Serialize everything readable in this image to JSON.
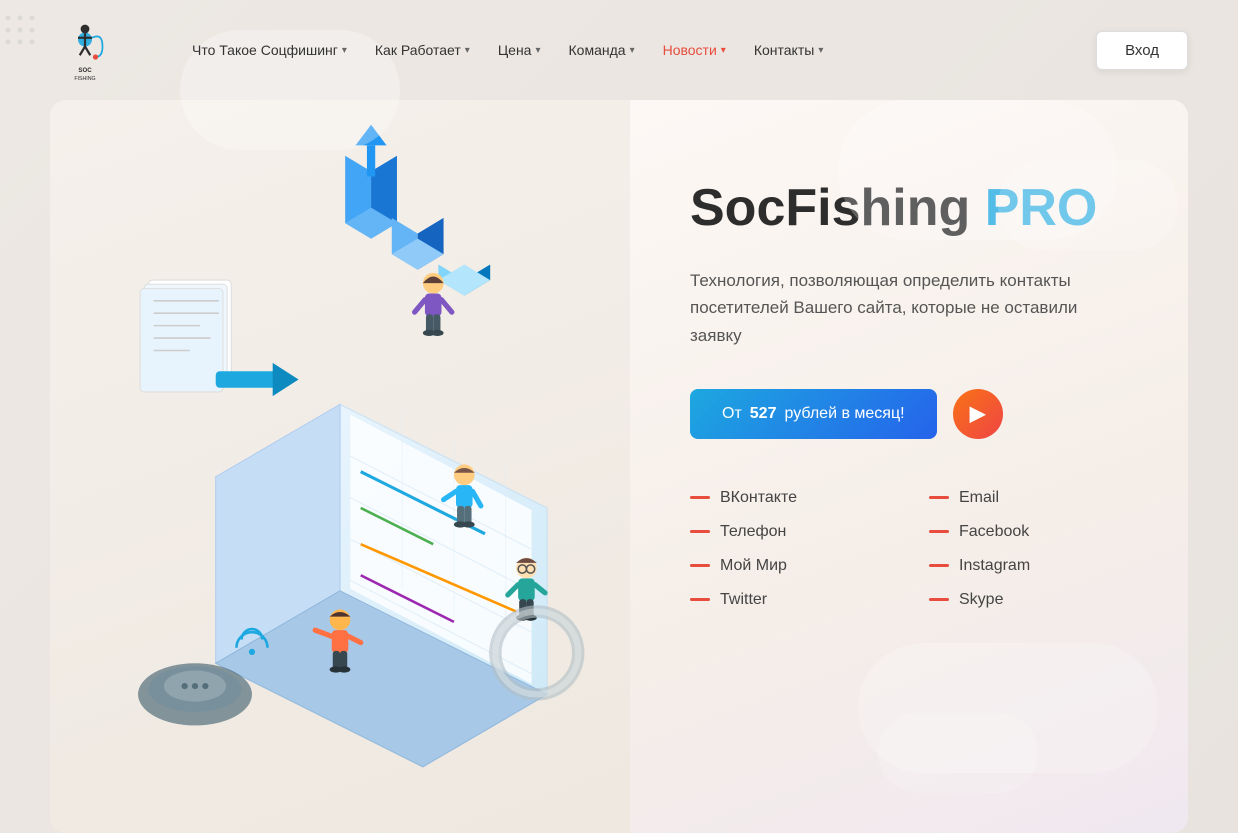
{
  "header": {
    "logo_text": "SOC FISHING",
    "nav_items": [
      {
        "label": "Что Такое Соцфишинг",
        "has_dropdown": true,
        "active": false
      },
      {
        "label": "Как Работает",
        "has_dropdown": true,
        "active": false
      },
      {
        "label": "Цена",
        "has_dropdown": true,
        "active": false
      },
      {
        "label": "Команда",
        "has_dropdown": true,
        "active": false
      },
      {
        "label": "Новости",
        "has_dropdown": true,
        "active": true
      },
      {
        "label": "Контакты",
        "has_dropdown": true,
        "active": false
      }
    ],
    "login_label": "Вход"
  },
  "hero": {
    "title_main": "SocFishing ",
    "title_pro": "PRO",
    "description": "Технология, позволяющая определить контакты посетителей Вашего сайта, которые не оставили заявку",
    "cta_label_prefix": "От ",
    "cta_price": "527",
    "cta_label_suffix": " рублей в месяц!"
  },
  "contacts": {
    "left": [
      {
        "label": "ВКонтакте"
      },
      {
        "label": "Телефон"
      },
      {
        "label": "Мой Мир"
      },
      {
        "label": "Twitter"
      }
    ],
    "right": [
      {
        "label": "Email"
      },
      {
        "label": "Facebook"
      },
      {
        "label": "Instagram"
      },
      {
        "label": "Skype"
      }
    ]
  },
  "colors": {
    "accent_blue": "#1da8e0",
    "accent_red": "#e74c3c",
    "accent_orange": "#f97316",
    "nav_active": "#e74c3c"
  }
}
